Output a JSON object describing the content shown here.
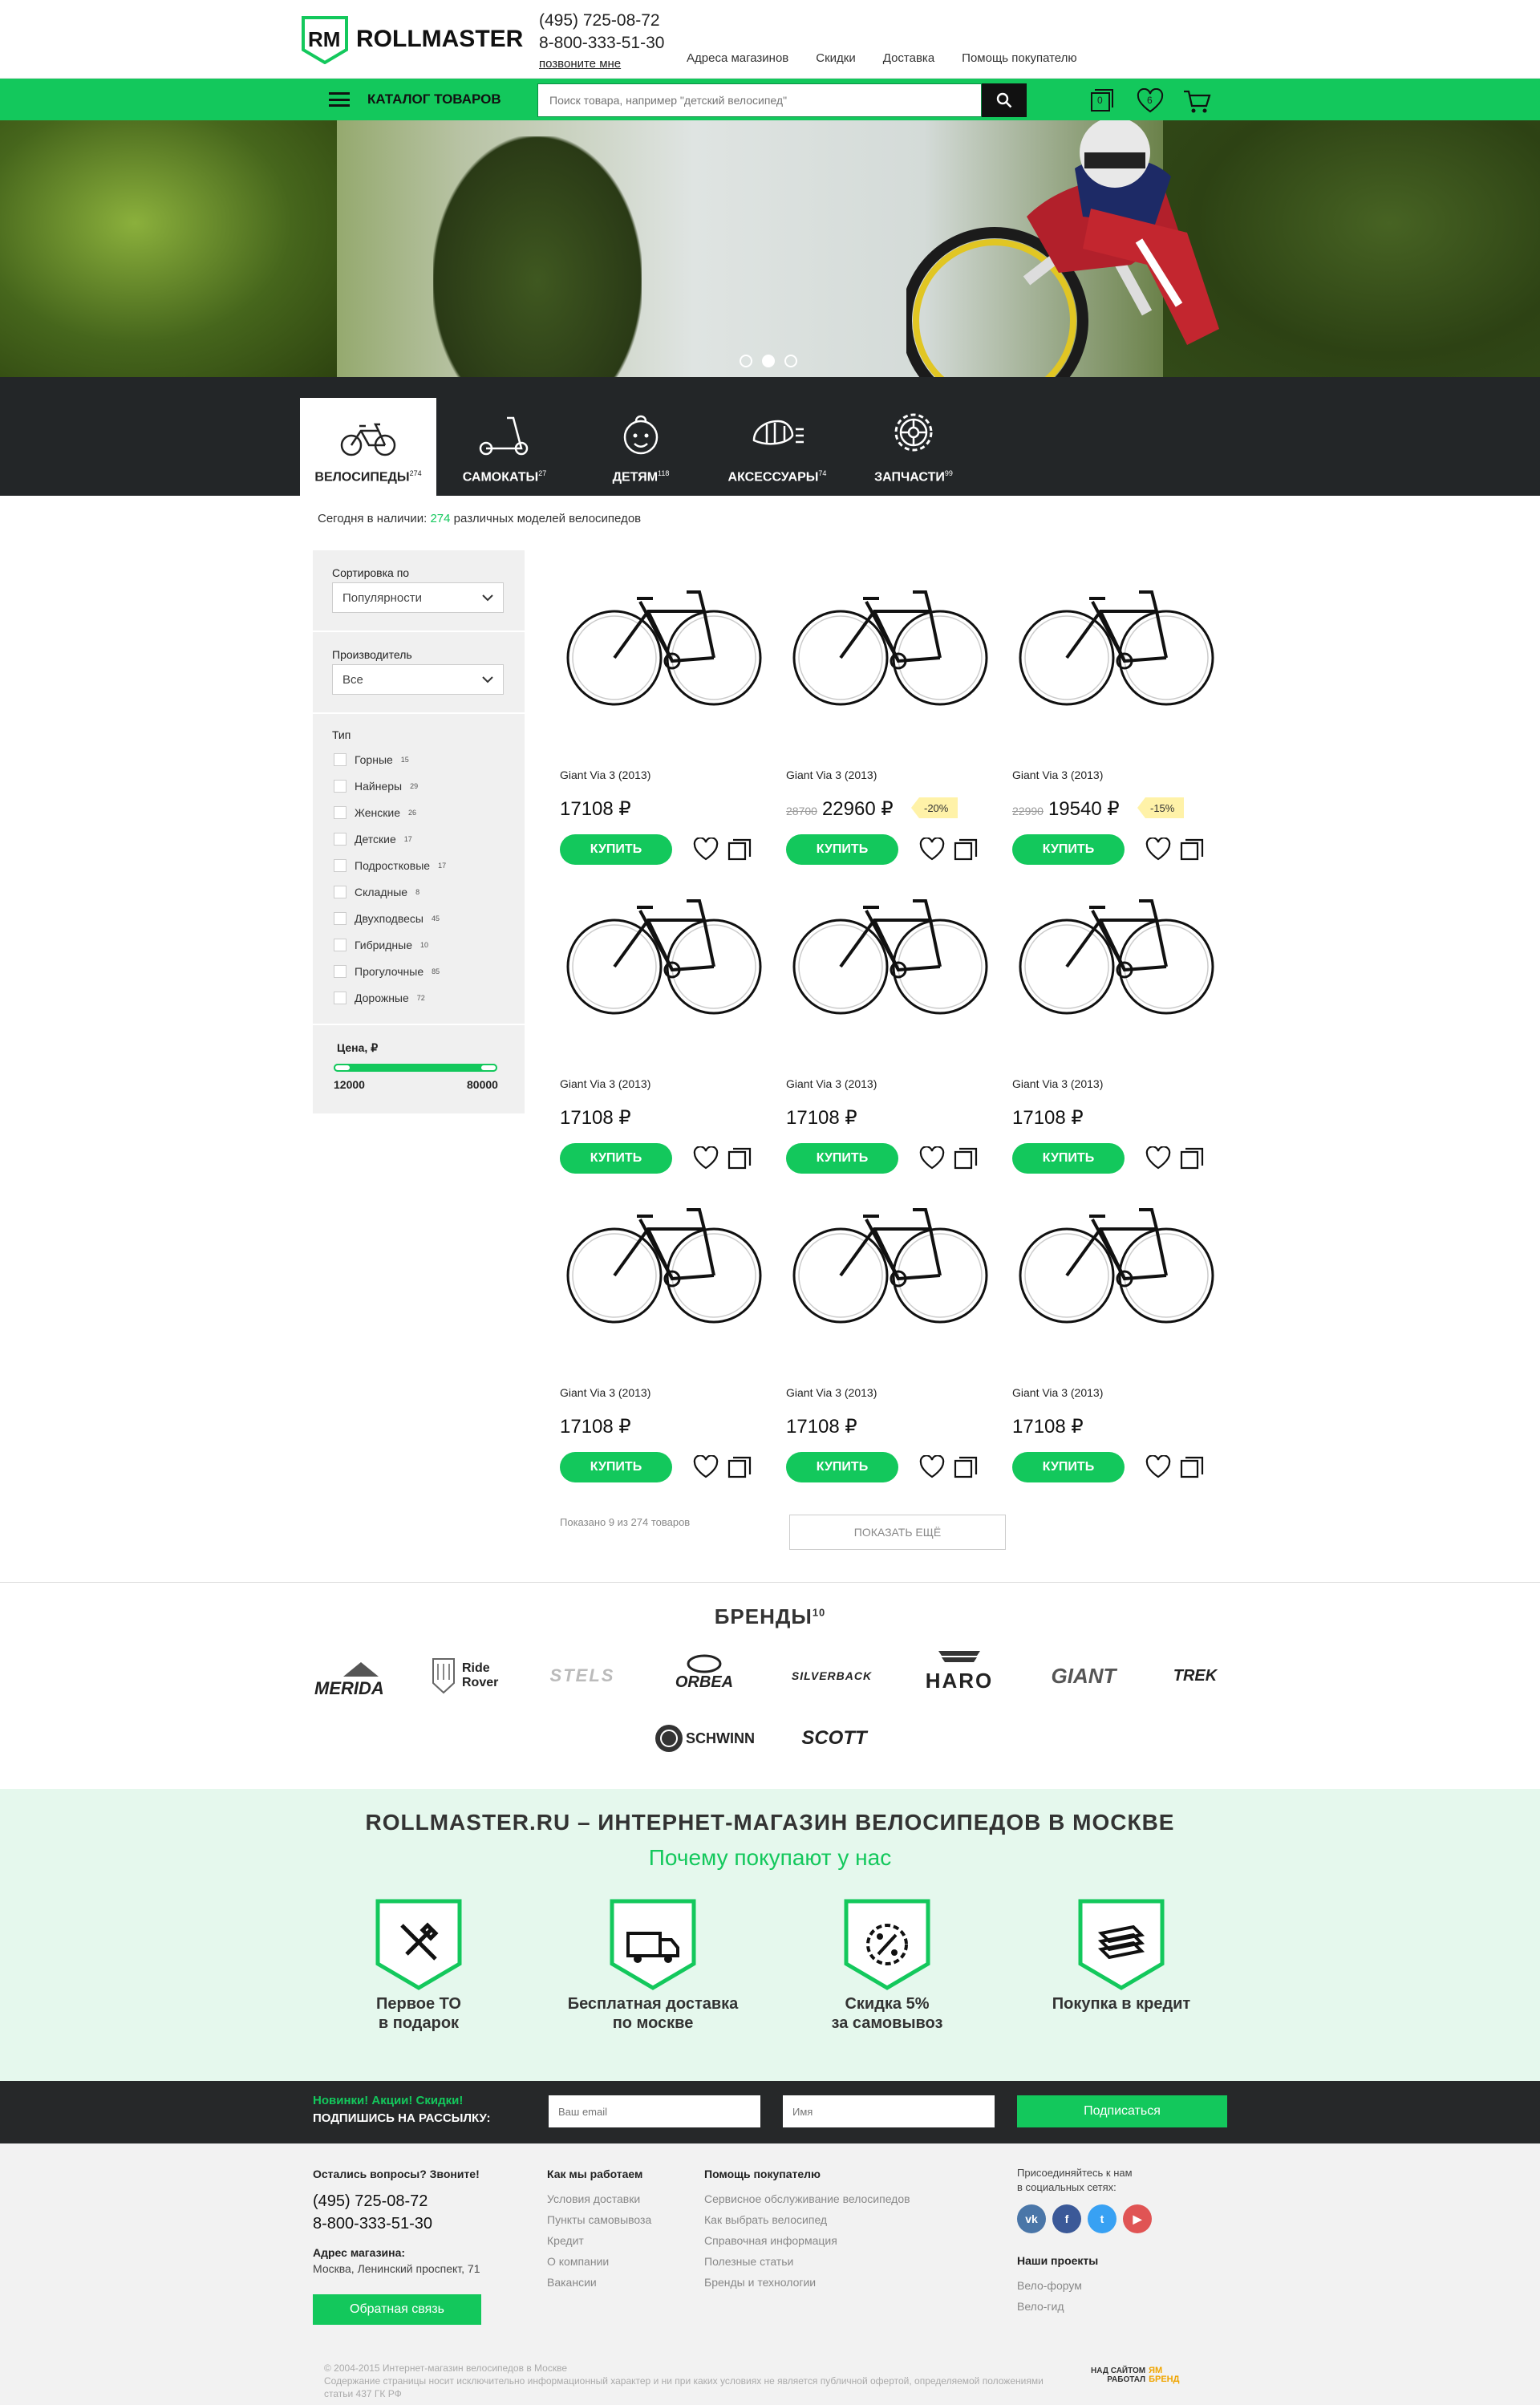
{
  "header": {
    "logo_text": "ROLLMASTER",
    "phone1": "(495) 725-08-72",
    "phone2": "8-800-333-51-30",
    "call_me": "позвоните мне",
    "nav": [
      "Адреса магазинов",
      "Скидки",
      "Доставка",
      "Помощь покупателю"
    ]
  },
  "bar": {
    "catalog": "КАТАЛОГ ТОВАРОВ",
    "search_placeholder": "Поиск товара, например \"детский велосипед\"",
    "compare_count": "0",
    "fav_count": "6"
  },
  "hero": {
    "slides": 3,
    "active_slide": 2
  },
  "categories": [
    {
      "label": "ВЕЛОСИПЕДЫ",
      "count": "274",
      "icon": "bicycle-icon",
      "active": true
    },
    {
      "label": "САМОКАТЫ",
      "count": "27",
      "icon": "scooter-icon",
      "active": false
    },
    {
      "label": "ДЕТЯМ",
      "count": "118",
      "icon": "baby-icon",
      "active": false
    },
    {
      "label": "АКСЕССУАРЫ",
      "count": "74",
      "icon": "accessories-icon",
      "active": false
    },
    {
      "label": "ЗАПЧАСТИ",
      "count": "99",
      "icon": "gear-icon",
      "active": false
    }
  ],
  "instock": {
    "prefix": "Сегодня в наличии:",
    "count": "274",
    "suffix": "различных моделей велосипедов"
  },
  "filters": {
    "sort_label": "Сортировка по",
    "sort_value": "Популярности",
    "maker_label": "Производитель",
    "maker_value": "Все",
    "type_label": "Тип",
    "types": [
      {
        "name": "Горные",
        "count": "15"
      },
      {
        "name": "Найнеры",
        "count": "29"
      },
      {
        "name": "Женские",
        "count": "26"
      },
      {
        "name": "Детские",
        "count": "17"
      },
      {
        "name": "Подростковые",
        "count": "17"
      },
      {
        "name": "Складные",
        "count": "8"
      },
      {
        "name": "Двухподвесы",
        "count": "45"
      },
      {
        "name": "Гибридные",
        "count": "10"
      },
      {
        "name": "Прогулочные",
        "count": "85"
      },
      {
        "name": "Дорожные",
        "count": "72"
      }
    ],
    "price_label": "Цена, ₽",
    "price_min": "12000",
    "price_max": "80000"
  },
  "products": [
    {
      "name": "Giant Via 3 (2013)",
      "price": "17108 ₽",
      "old": "",
      "disc": ""
    },
    {
      "name": "Giant Via 3 (2013)",
      "price": "22960 ₽",
      "old": "28700",
      "disc": "-20%"
    },
    {
      "name": "Giant Via 3 (2013)",
      "price": "19540 ₽",
      "old": "22990",
      "disc": "-15%"
    },
    {
      "name": "Giant Via 3 (2013)",
      "price": "17108 ₽",
      "old": "",
      "disc": ""
    },
    {
      "name": "Giant Via 3 (2013)",
      "price": "17108 ₽",
      "old": "",
      "disc": ""
    },
    {
      "name": "Giant Via 3 (2013)",
      "price": "17108 ₽",
      "old": "",
      "disc": ""
    },
    {
      "name": "Giant Via 3 (2013)",
      "price": "17108 ₽",
      "old": "",
      "disc": ""
    },
    {
      "name": "Giant Via 3 (2013)",
      "price": "17108 ₽",
      "old": "",
      "disc": ""
    },
    {
      "name": "Giant Via 3 (2013)",
      "price": "17108 ₽",
      "old": "",
      "disc": ""
    }
  ],
  "buy_label": "КУПИТЬ",
  "list": {
    "shown": "Показано 9 из 274 товаров",
    "more": "ПОКАЗАТЬ ЕЩЁ"
  },
  "brands": {
    "title": "БРЕНДЫ",
    "count": "10",
    "items": [
      "MERIDA",
      "Ride Rover",
      "STELS",
      "ORBEA",
      "SILVERBACK",
      "HARO",
      "GIANT",
      "TREK",
      "SCHWINN",
      "SCOTT"
    ]
  },
  "why": {
    "title": "ROLLMASTER.RU – ИНТЕРНЕТ-МАГАЗИН ВЕЛОСИПЕДОВ В МОСКВЕ",
    "subtitle": "Почему покупают у нас",
    "items": [
      {
        "l1": "Первое ТО",
        "l2": "в подарок",
        "icon": "tools-icon"
      },
      {
        "l1": "Бесплатная доставка",
        "l2": "по москве",
        "icon": "truck-icon"
      },
      {
        "l1": "Скидка 5%",
        "l2": "за самовывоз",
        "icon": "percent-badge-icon"
      },
      {
        "l1": "Покупка в кредит",
        "l2": "",
        "icon": "money-icon"
      }
    ]
  },
  "subscribe": {
    "line1": "Новинки! Акции! Скидки!",
    "line2": "ПОДПИШИСЬ НА РАССЫЛКУ:",
    "email_ph": "Ваш email",
    "name_ph": "Имя",
    "button": "Подписаться"
  },
  "footer": {
    "call_title": "Остались вопросы? Звоните!",
    "phone1": "(495) 725-08-72",
    "phone2": "8-800-333-51-30",
    "addr_title": "Адрес магазина:",
    "addr": "Москва, Ленинский проспект, 71",
    "feedback": "Обратная связь",
    "col1_title": "Как мы работаем",
    "col1": [
      "Условия доставки",
      "Пункты самовывоза",
      "Кредит",
      "О компании",
      "Вакансии"
    ],
    "col2_title": "Помощь покупателю",
    "col2": [
      "Сервисное обслуживание велосипедов",
      "Как выбрать велосипед",
      "Справочная информация",
      "Полезные статьи",
      "Бренды и технологии"
    ],
    "social_l1": "Присоединяйтесь к нам",
    "social_l2": "в социальных сетях:",
    "projects_title": "Наши проекты",
    "projects": [
      "Вело-форум",
      "Вело-гид"
    ],
    "copy1": "© 2004-2015 Интернет-магазин велосипедов в Москве",
    "copy2": "Содержание страницы носит исключительно информационный характер и ни при каких условиях не является публичной офертой, определяемой положениями",
    "copy3": "статьи 437 ГК РФ",
    "made_by_l1": "НАД САЙТОМ",
    "made_by_l2": "РАБОТАЛ",
    "made_by_brand": "ЯМ БРЕНД"
  }
}
